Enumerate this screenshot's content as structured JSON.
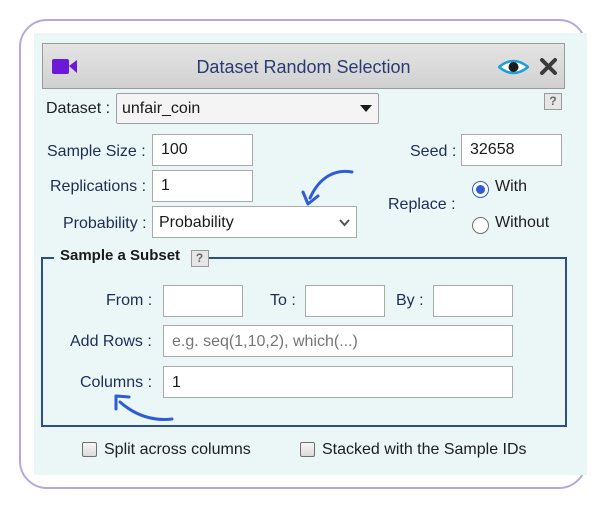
{
  "dialog": {
    "title": "Dataset Random Selection",
    "help_label": "?"
  },
  "dataset": {
    "label": "Dataset :",
    "value": "unfair_coin"
  },
  "sample_size": {
    "label": "Sample Size :",
    "value": "100"
  },
  "seed": {
    "label": "Seed :",
    "value": "32658"
  },
  "replications": {
    "label": "Replications :",
    "value": "1"
  },
  "probability": {
    "label": "Probability :",
    "value": "Probability"
  },
  "replace": {
    "label": "Replace :",
    "options": [
      "With",
      "Without"
    ],
    "selected": "With"
  },
  "subset": {
    "legend": "Sample a Subset",
    "from_label": "From :",
    "from_value": "",
    "to_label": "To :",
    "to_value": "",
    "by_label": "By :",
    "by_value": "",
    "add_rows_label": "Add Rows :",
    "add_rows_placeholder": "e.g. seq(1,10,2), which(...)",
    "columns_label": "Columns :",
    "columns_value": "1"
  },
  "options": {
    "split_label": "Split across columns",
    "split_checked": false,
    "stacked_label": "Stacked with the Sample IDs",
    "stacked_checked": false
  },
  "icons": {
    "title": "video-camera-icon",
    "preview": "eye-icon",
    "close": "close-icon",
    "arrows": "annotation-arrow"
  },
  "colors": {
    "accent": "#2f5bd6",
    "title_text": "#2a3b73",
    "camera": "#6a19d8",
    "border": "#2e4e86"
  }
}
